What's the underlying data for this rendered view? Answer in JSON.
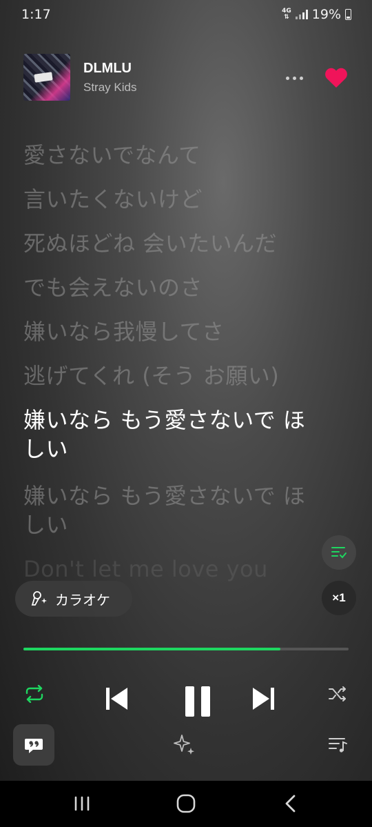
{
  "status_bar": {
    "time": "1:17",
    "network": "4G",
    "battery": "19%"
  },
  "track": {
    "title": "DLMLU",
    "artist": "Stray Kids",
    "liked": true,
    "accent_color": "#1ed760",
    "heart_color": "#f0145a"
  },
  "lyrics": [
    "愛さないでなんて",
    "言いたくないけど",
    "死ぬほどね 会いたいんだ",
    "でも会えないのさ",
    "嫌いなら我慢してさ",
    "逃げてくれ (そう お願い)",
    "嫌いなら もう愛さないで ほしい",
    "嫌いなら もう愛さないで ほしい",
    "Don't let me love you"
  ],
  "active_line_index": 6,
  "karaoke": {
    "label": "カラオケ",
    "icon": "microphone-sparkle-icon"
  },
  "playback_speed": "×1",
  "progress_fraction": 0.79,
  "controls": {
    "repeat": "repeat-icon",
    "previous": "skip-previous-icon",
    "pause": "pause-icon",
    "next": "skip-next-icon",
    "shuffle": "shuffle-icon",
    "lyrics": "quote-icon",
    "sparkle": "sparkle-icon",
    "queue": "queue-music-icon"
  }
}
